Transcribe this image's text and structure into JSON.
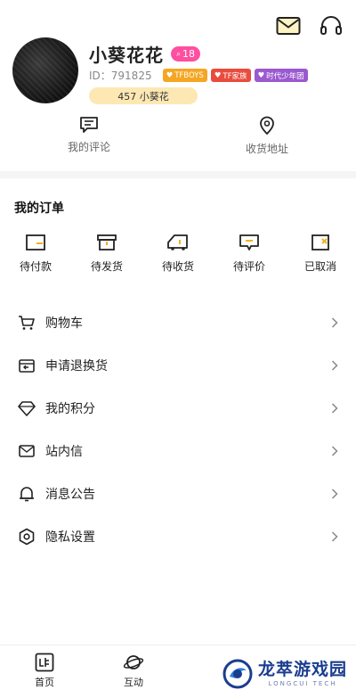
{
  "header": {
    "icons": [
      "mail-icon",
      "headset-icon"
    ]
  },
  "profile": {
    "username": "小葵花花",
    "level": "18",
    "uid_label": "ID：",
    "uid": "791825",
    "tags": [
      "TFBOYS",
      "TF家族",
      "时代少年团"
    ],
    "fan_pill": "457 小葵花"
  },
  "quick_links": [
    {
      "label": "我的评论",
      "icon": "comment-icon"
    },
    {
      "label": "收货地址",
      "icon": "location-icon"
    }
  ],
  "orders": {
    "title": "我的订单",
    "items": [
      {
        "label": "待付款",
        "icon": "wallet-icon"
      },
      {
        "label": "待发货",
        "icon": "box-icon"
      },
      {
        "label": "待收货",
        "icon": "truck-icon"
      },
      {
        "label": "待评价",
        "icon": "review-icon"
      },
      {
        "label": "已取消",
        "icon": "cancel-doc-icon"
      }
    ]
  },
  "menu": [
    {
      "label": "购物车",
      "icon": "cart-icon"
    },
    {
      "label": "申请退换货",
      "icon": "return-icon"
    },
    {
      "label": "我的积分",
      "icon": "diamond-icon"
    },
    {
      "label": "站内信",
      "icon": "envelope-icon"
    },
    {
      "label": "消息公告",
      "icon": "bell-icon"
    },
    {
      "label": "隐私设置",
      "icon": "settings-icon"
    }
  ],
  "tabs": [
    {
      "label": "首页",
      "icon": "home-icon"
    },
    {
      "label": "互动",
      "icon": "planet-icon"
    }
  ],
  "watermark": {
    "title": "龙萃游戏园",
    "subtitle": "LONGCUI TECH"
  },
  "colors": {
    "level_badge": "#ff4fa0",
    "tag1": "#f5a623",
    "tag2": "#e94c3d",
    "tag3": "#9b59d0",
    "fan_pill": "#fde8b4",
    "accent_yellow": "#f2b11f"
  }
}
